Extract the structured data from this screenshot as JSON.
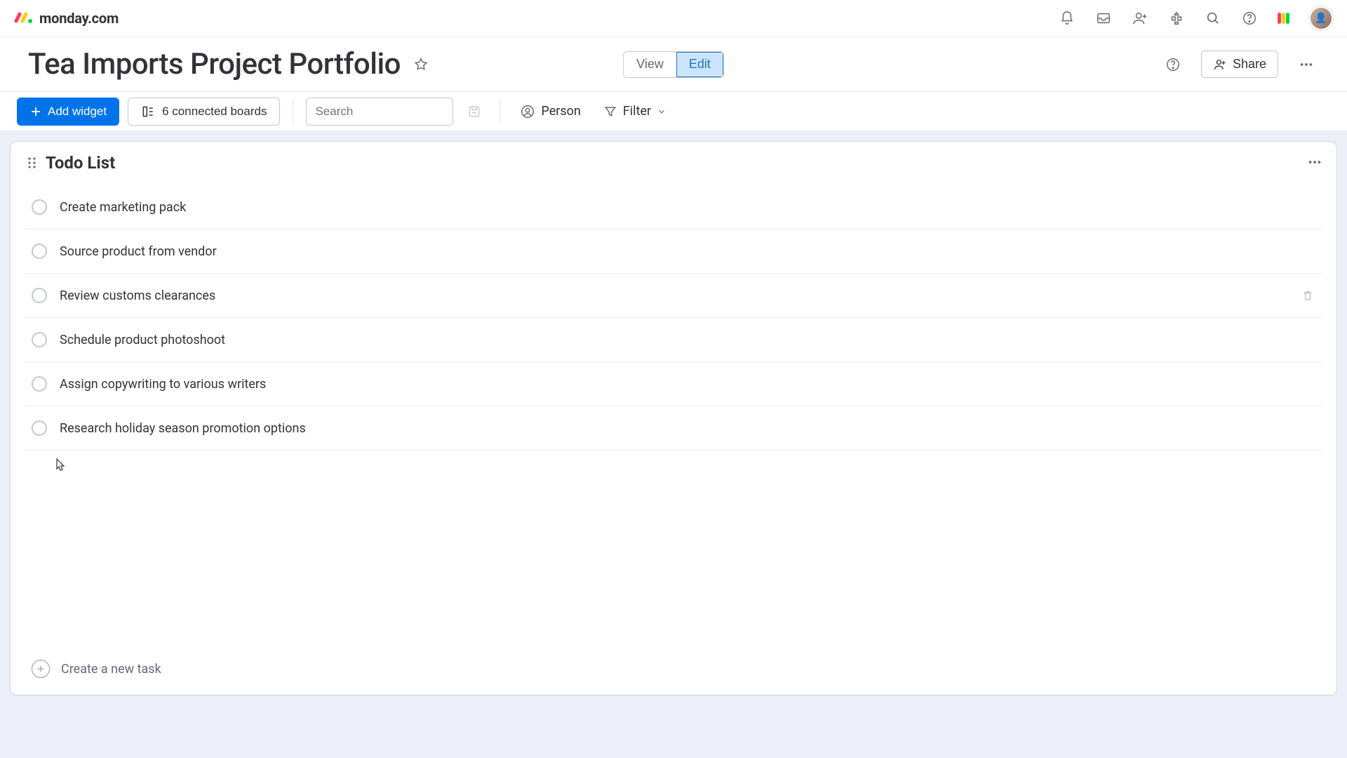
{
  "brand": {
    "name": "monday.com"
  },
  "board": {
    "title": "Tea Imports Project Portfolio",
    "view_label": "View",
    "edit_label": "Edit",
    "share_label": "Share"
  },
  "toolbar": {
    "add_widget_label": "Add widget",
    "connected_boards_label": "6 connected boards",
    "search_placeholder": "Search",
    "person_label": "Person",
    "filter_label": "Filter"
  },
  "widget": {
    "title": "Todo List",
    "create_task_label": "Create a new task",
    "items": [
      {
        "label": "Create marketing pack"
      },
      {
        "label": "Source product from vendor"
      },
      {
        "label": "Review customs clearances"
      },
      {
        "label": "Schedule product photoshoot"
      },
      {
        "label": "Assign copywriting to various writers"
      },
      {
        "label": "Research holiday season promotion options"
      }
    ]
  }
}
